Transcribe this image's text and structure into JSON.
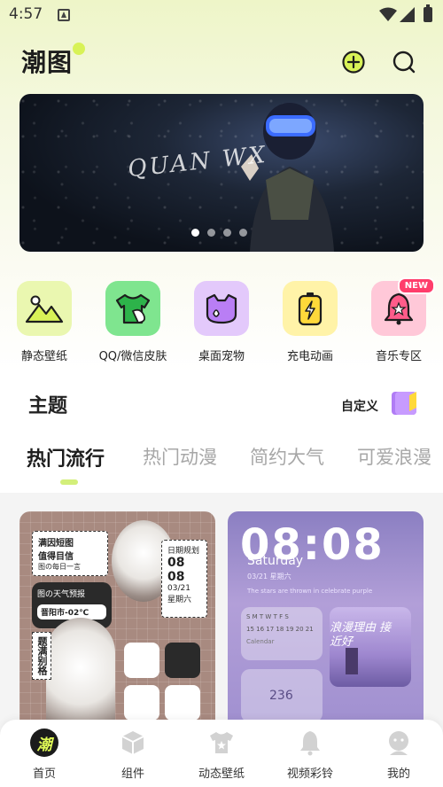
{
  "status_bar": {
    "time": "4:57"
  },
  "header": {
    "logo": "潮图"
  },
  "banner": {
    "signature": "QUAN WX",
    "dots": 4,
    "active_dot": 0
  },
  "categories": [
    {
      "label": "静态壁纸",
      "icon": "mountain-image-icon",
      "bg": "#eaf7b0"
    },
    {
      "label": "QQ/微信皮肤",
      "icon": "tshirt-icon",
      "bg": "#7fe58f"
    },
    {
      "label": "桌面宠物",
      "icon": "cat-face-icon",
      "bg": "#e3c9fb"
    },
    {
      "label": "充电动画",
      "icon": "battery-charge-icon",
      "bg": "#fff3a8"
    },
    {
      "label": "音乐专区",
      "icon": "bell-star-icon",
      "bg": "#ffc8d8",
      "badge": "NEW"
    }
  ],
  "theme_section": {
    "title": "主题",
    "custom_label": "自定义"
  },
  "tabs": [
    {
      "label": "热门流行",
      "active": true
    },
    {
      "label": "热门动漫"
    },
    {
      "label": "简约大气"
    },
    {
      "label": "可爱浪漫"
    }
  ],
  "cards": {
    "card1": {
      "note1_line1": "满因短图",
      "note1_line2": "值得目信",
      "note1_line3": "图の每日一言",
      "weather_label": "图の天气预报",
      "weather_value": "晋阳市-02℃",
      "date_line1": "日期规划",
      "date_d1": "08",
      "date_d2": "08",
      "date_d3": "03/21",
      "date_week": "星期六",
      "side_note": "题满别格"
    },
    "card2": {
      "time": "08:08",
      "day": "Saturday",
      "date": "03/21 星期六",
      "tiny_text": "The stars are thrown in celebrate purple",
      "cal_header": "S M T W T F S",
      "cal_row1": "15 16 17 18 19 20 21",
      "cal_label": "Calendar",
      "glass_value": "236",
      "handwriting": "浪漫理由 接近好"
    }
  },
  "bottom_nav": [
    {
      "label": "首页",
      "active": true,
      "icon": "home-chao-icon"
    },
    {
      "label": "组件",
      "icon": "cube-icon"
    },
    {
      "label": "动态壁纸",
      "icon": "tshirt-star-icon"
    },
    {
      "label": "视频彩铃",
      "icon": "bell-icon"
    },
    {
      "label": "我的",
      "icon": "profile-icon"
    }
  ],
  "colors": {
    "accent": "#d8f257",
    "new_badge": "#ff3d6b",
    "active_tab_indicator": "#d3ef7a"
  }
}
